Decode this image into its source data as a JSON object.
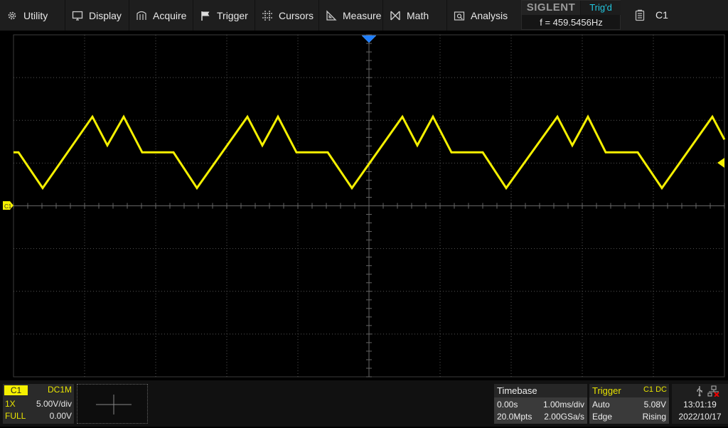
{
  "menu": {
    "items": [
      {
        "label": "Utility",
        "icon": "gear-icon"
      },
      {
        "label": "Display",
        "icon": "monitor-icon"
      },
      {
        "label": "Acquire",
        "icon": "acquire-icon"
      },
      {
        "label": "Trigger",
        "icon": "flag-icon"
      },
      {
        "label": "Cursors",
        "icon": "cursors-grid-icon"
      },
      {
        "label": "Measure",
        "icon": "set-square-icon"
      },
      {
        "label": "Math",
        "icon": "math-icon"
      },
      {
        "label": "Analysis",
        "icon": "analysis-icon"
      }
    ]
  },
  "status": {
    "brand": "SIGLENT",
    "trigger_state": "Trig'd",
    "frequency": "f = 459.5456Hz",
    "active_channel": "C1"
  },
  "channel": {
    "name": "C1",
    "coupling": "DC1M",
    "probe": "1X",
    "scale": "5.00V/div",
    "bandwidth": "FULL",
    "offset": "0.00V",
    "color": "#f5f000"
  },
  "timebase": {
    "title": "Timebase",
    "delay": "0.00s",
    "scale": "1.00ms/div",
    "memory_depth": "20.0Mpts",
    "sample_rate": "2.00GSa/s"
  },
  "trigger": {
    "title": "Trigger",
    "source": "C1",
    "coupling": "DC",
    "mode": "Auto",
    "level": "5.08V",
    "type": "Edge",
    "slope": "Rising"
  },
  "system": {
    "time": "13:01:19",
    "date": "2022/10/17",
    "usb_icon": "usb-icon",
    "network_icon": "network-disconnected-icon"
  },
  "waveform": {
    "time_per_div_ms": 1.0,
    "volts_per_div": 5.0,
    "frequency_hz": 459.5456,
    "points_ms_v": [
      [
        -5.0,
        6.25
      ],
      [
        -4.93,
        6.25
      ],
      [
        -4.59,
        2.08
      ],
      [
        -3.89,
        10.42
      ],
      [
        -3.68,
        7.08
      ],
      [
        -3.45,
        10.42
      ],
      [
        -3.19,
        6.25
      ],
      [
        -2.75,
        6.25
      ],
      [
        -2.42,
        2.08
      ],
      [
        -1.71,
        10.42
      ],
      [
        -1.5,
        7.08
      ],
      [
        -1.28,
        10.42
      ],
      [
        -1.02,
        6.25
      ],
      [
        -0.58,
        6.25
      ],
      [
        -0.24,
        2.08
      ],
      [
        0.47,
        10.42
      ],
      [
        0.68,
        7.08
      ],
      [
        0.9,
        10.42
      ],
      [
        1.16,
        6.25
      ],
      [
        1.6,
        6.25
      ],
      [
        1.93,
        2.08
      ],
      [
        2.65,
        10.42
      ],
      [
        2.86,
        7.08
      ],
      [
        3.08,
        10.42
      ],
      [
        3.33,
        6.25
      ],
      [
        3.78,
        6.25
      ],
      [
        4.12,
        2.08
      ],
      [
        4.83,
        10.42
      ],
      [
        5.0,
        7.75
      ]
    ]
  }
}
